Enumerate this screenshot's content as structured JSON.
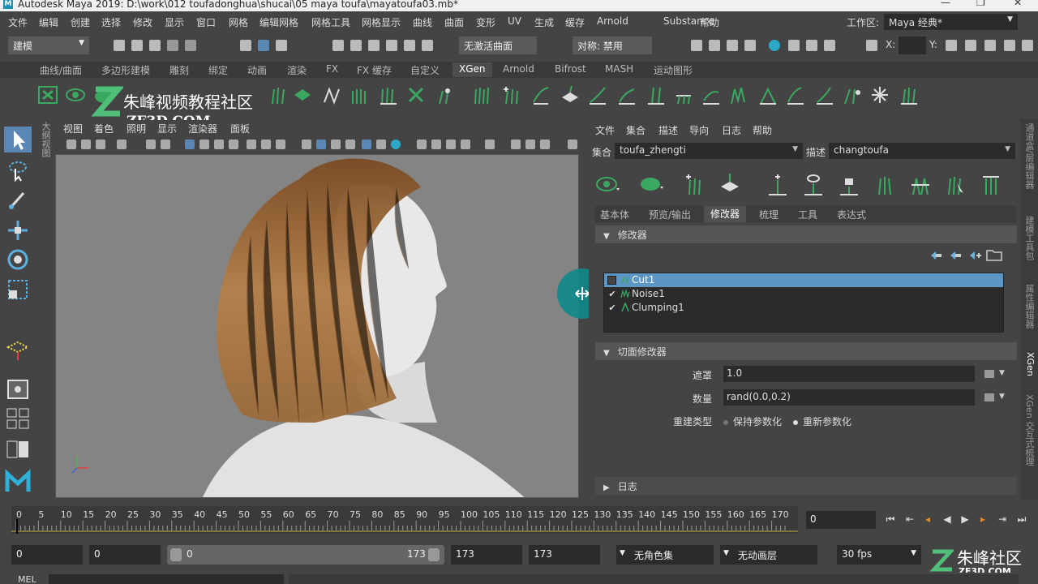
{
  "title_bar": {
    "title": "Autodesk Maya 2019: D:\\work\\012 toufadonghua\\shucai\\05 maya toufa\\mayatoufa03.mb*"
  },
  "menu": {
    "items": [
      "文件",
      "编辑",
      "创建",
      "选择",
      "修改",
      "显示",
      "窗口",
      "网格",
      "编辑网格",
      "网格工具",
      "网格显示",
      "曲线",
      "曲面",
      "变形",
      "UV",
      "生成",
      "缓存",
      "Arnold",
      "Substance",
      "帮助"
    ]
  },
  "workspace": {
    "label": "工作区:",
    "value": "Maya 经典*"
  },
  "status_line": {
    "mode": "建模",
    "live_surface": "无激活曲面",
    "symmetry": "对称: 禁用",
    "x_label": "X:",
    "y_label": "Y:"
  },
  "shelf": {
    "tabs": [
      "曲线/曲面",
      "多边形建模",
      "雕刻",
      "绑定",
      "动画",
      "渲染",
      "FX",
      "FX 缓存",
      "自定义",
      "XGen",
      "Arnold",
      "Bifrost",
      "MASH",
      "运动图形"
    ],
    "active": "XGen"
  },
  "watermark": {
    "line1": "朱峰视频教程社区",
    "line2": "ZF3D.COM"
  },
  "side_label": "大纲视图",
  "viewport": {
    "menus": [
      "视图",
      "着色",
      "照明",
      "显示",
      "渲染器",
      "面板"
    ]
  },
  "xgen": {
    "menus": [
      "文件",
      "集合",
      "描述",
      "导向",
      "日志",
      "帮助"
    ],
    "collection_label": "集合",
    "collection_value": "toufa_zhengti",
    "description_label": "描述",
    "description_value": "changtoufa",
    "tabs": [
      "基本体",
      "预览/输出",
      "修改器",
      "梳理",
      "工具",
      "表达式"
    ],
    "active_tab": "修改器",
    "modifiers_header": "修改器",
    "modifiers": [
      {
        "name": "Cut1",
        "checked": false,
        "selected": true
      },
      {
        "name": "Noise1",
        "checked": true,
        "selected": false
      },
      {
        "name": "Clumping1",
        "checked": true,
        "selected": false
      }
    ],
    "cut_header": "切面修改器",
    "mask_label": "遮罩",
    "mask_value": "1.0",
    "amount_label": "数量",
    "amount_value": "rand(0.0,0.2)",
    "rebuild_label": "重建类型",
    "rebuild_opt1": "保持参数化",
    "rebuild_opt2": "重新参数化",
    "rebuild_selected": "重新参数化",
    "log_header": "日志"
  },
  "right_strip": [
    "通道盒/层编辑器",
    "建模工具包",
    "属性编辑器",
    "XGen",
    "XGen 交互式梳理"
  ],
  "timeline": {
    "ticks": [
      "0",
      "5",
      "10",
      "15",
      "20",
      "25",
      "30",
      "35",
      "40",
      "45",
      "50",
      "55",
      "60",
      "65",
      "70",
      "75",
      "80",
      "85",
      "90",
      "95",
      "100",
      "105",
      "110",
      "115",
      "120",
      "125",
      "130",
      "135",
      "140",
      "145",
      "150",
      "155",
      "160",
      "165",
      "170"
    ],
    "current_frame": "0"
  },
  "range": {
    "start": "0",
    "anim_start": "0",
    "slider_start": "0",
    "slider_end": "173",
    "anim_end": "173",
    "end": "173",
    "char_set": "无角色集",
    "anim_layer": "无动画层",
    "fps": "30 fps"
  },
  "command_line": {
    "label": "MEL"
  },
  "corner_watermark": {
    "text1": "朱峰社区",
    "text2": "ZF3D.COM"
  },
  "colors": {
    "accent": "#5c96c4",
    "xgen_green": "#3aa860",
    "hair": "#b5804a",
    "teal_cursor": "#0f8a8a"
  }
}
